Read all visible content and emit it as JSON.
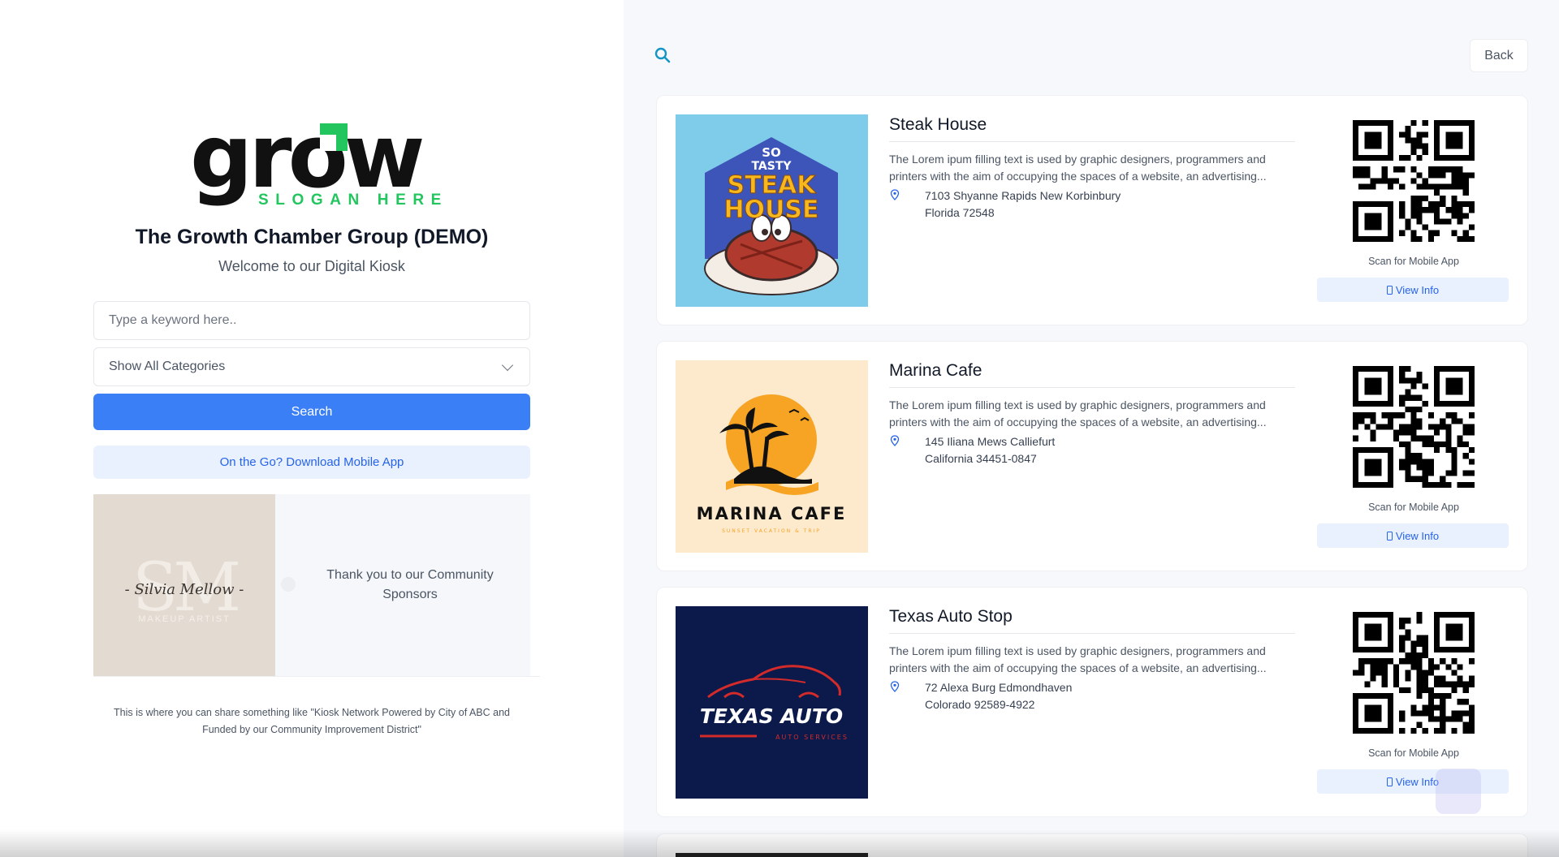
{
  "logo": {
    "word": "grow",
    "slogan": "SLOGAN HERE",
    "colors": {
      "text": "#111111",
      "accent": "#22c55e"
    }
  },
  "org": {
    "title": "The Growth Chamber Group (DEMO)",
    "welcome": "Welcome to our Digital Kiosk"
  },
  "search": {
    "placeholder": "Type a keyword here..",
    "value": "",
    "category_selected": "Show All Categories",
    "button_label": "Search"
  },
  "mobile_app": {
    "label": "On the Go? Download Mobile App"
  },
  "sponsor": {
    "logo_initials": "SM",
    "logo_script": "- Silvia Mellow -",
    "logo_subtitle": "MAKEUP ARTIST",
    "text": "Thank you to our Community Sponsors"
  },
  "footer_note": "This is where you can share something like \"Kiosk Network Powered by City of ABC and Funded by our Community Improvement District\"",
  "header": {
    "back_label": "Back",
    "search_icon": "search-icon"
  },
  "listings": [
    {
      "title": "Steak House",
      "description": "The Lorem ipum filling text is used by graphic designers, programmers and printers with the aim of occupying the spaces of a website, an advertising...",
      "address_line1": "7103 Shyanne Rapids New Korbinbury",
      "address_line2": "Florida 72548",
      "qr_caption": "Scan for Mobile App",
      "view_label": "View Info",
      "logo": {
        "top": "SO",
        "mid": "TASTY",
        "main1": "STEAK",
        "main2": "HOUSE",
        "bg": "#7ecbea"
      }
    },
    {
      "title": "Marina Cafe",
      "description": "The Lorem ipum filling text is used by graphic designers, programmers and printers with the aim of occupying the spaces of a website, an advertising...",
      "address_line1": "145 Iliana Mews Calliefurt",
      "address_line2": "California 34451-0847",
      "qr_caption": "Scan for Mobile App",
      "view_label": "View Info",
      "logo": {
        "name": "MARINA CAFE",
        "tagline": "SUNSET VACATION & TRIP",
        "bg": "#fde9cc"
      }
    },
    {
      "title": "Texas Auto Stop",
      "description": "The Lorem ipum filling text is used by graphic designers, programmers and printers with the aim of occupying the spaces of a website, an advertising...",
      "address_line1": "72 Alexa Burg Edmondhaven",
      "address_line2": "Colorado 92589-4922",
      "qr_caption": "Scan for Mobile App",
      "view_label": "View Info",
      "logo": {
        "name": "TEXAS AUTO",
        "tagline": "AUTO SERVICES",
        "bg": "#0b1a4a"
      }
    }
  ],
  "colors": {
    "primary": "#3b7ff6",
    "primary_light": "#eaf1fe",
    "link": "#2563eb",
    "panel_bg": "#f6f8fb"
  }
}
